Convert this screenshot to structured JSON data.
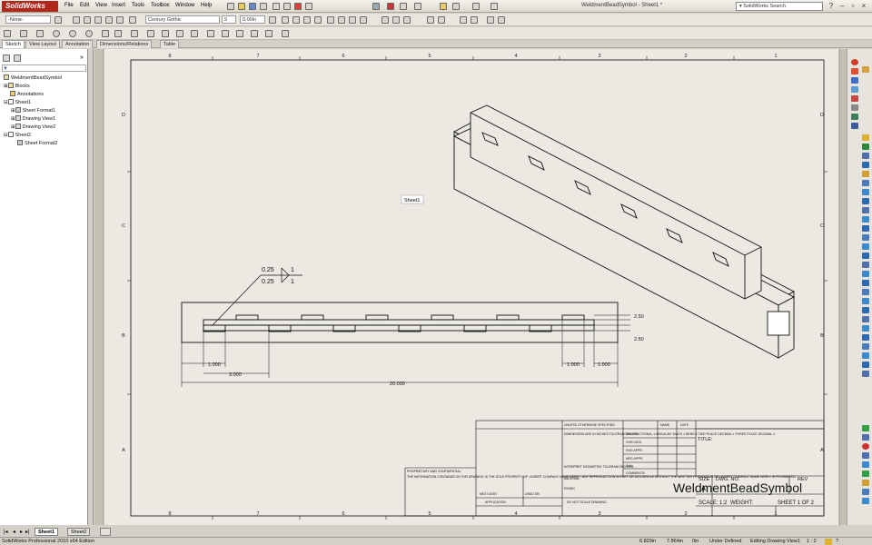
{
  "app": {
    "logo": "SolidWorks",
    "title": "WeldmentBeadSymbol - Sheet1 *",
    "search_placeholder": "SolidWorks Search"
  },
  "menu": [
    "File",
    "Edit",
    "View",
    "Insert",
    "Tools",
    "Toolbox",
    "Window",
    "Help"
  ],
  "format": {
    "layer": "-None-",
    "font": "Century Gothic",
    "size": "9",
    "spacing": "0.00in"
  },
  "tabs": [
    "Sketch",
    "View Layout",
    "Annotation",
    "Dimensions/Relations",
    "Table"
  ],
  "tree": [
    {
      "label": "WeldmentBeadSymbol",
      "icon": "drawing-icon"
    },
    {
      "label": "Blocks",
      "icon": "folder-icon"
    },
    {
      "label": "Annotations",
      "icon": "annotations-icon"
    },
    {
      "label": "Sheet1",
      "icon": "sheet-icon"
    },
    {
      "label": "Sheet Format1",
      "icon": "sheet-format-icon"
    },
    {
      "label": "Drawing View1",
      "icon": "view-icon"
    },
    {
      "label": "Drawing View2",
      "icon": "view-icon"
    },
    {
      "label": "Sheet2",
      "icon": "sheet-icon"
    },
    {
      "label": "Sheet Format2",
      "icon": "sheet-format-icon"
    }
  ],
  "drawing": {
    "zone_cols": [
      "8",
      "7",
      "6",
      "5",
      "4",
      "3",
      "2",
      "1"
    ],
    "zone_rows": [
      "D",
      "C",
      "B",
      "A"
    ],
    "sheet_label": "Sheet1",
    "weld_top": "0.25",
    "weld_bottom": "0.25",
    "weld_top_count": "1",
    "weld_bottom_count": "1",
    "dim_250a": "2.50",
    "dim_250b": "2.50",
    "dim_1000a": "1.000",
    "dim_3000": "3.000",
    "dim_1000b": "1.000",
    "dim_1000c": "1.000",
    "dim_20000": "20.000"
  },
  "title_block": {
    "unless": "UNLESS OTHERWISE SPECIFIED:",
    "name": "NAME",
    "date": "DATE",
    "drawn": "DRAWN",
    "checked": "CHECKED",
    "eng_appr": "ENG APPR.",
    "mfg_appr": "MFG APPR.",
    "qa": "Q.A.",
    "comments": "COMMENTS:",
    "dims_note": "DIMENSIONS ARE IN INCHES TOLERANCES: FRACTIONAL ± ANGULAR: MACH ± BEND ± TWO PLACE DECIMAL ± THREE PLACE DECIMAL ±",
    "interpret": "INTERPRET GEOMETRIC TOLERANCING PER:",
    "material": "MATERIAL",
    "finish": "FINISH",
    "next_assy": "NEXT ASSY",
    "used_on": "USED ON",
    "application": "APPLICATION",
    "do_not_scale": "DO NOT SCALE DRAWING",
    "proprietary_title": "PROPRIETARY AND CONFIDENTIAL",
    "proprietary_text": "THE INFORMATION CONTAINED IN THIS DRAWING IS THE SOLE PROPERTY OF <INSERT COMPANY NAME HERE>. ANY REPRODUCTION IN PART OR AS A WHOLE WITHOUT THE WRITTEN PERMISSION OF <INSERT COMPANY NAME HERE> IS PROHIBITED.",
    "title": "TITLE:",
    "size": "SIZE",
    "size_val": "A",
    "dwg_no": "DWG.  NO.",
    "rev": "REV",
    "part_name": "WeldmentBeadSymbol",
    "scale": "SCALE: 1:2",
    "weight": "WEIGHT:",
    "sheet": "SHEET 1 OF 2"
  },
  "sheet_tabs": [
    "Sheet1",
    "Sheet2"
  ],
  "status": {
    "app": "SolidWorks Professional 2010 x64 Edition",
    "x": "6.829in",
    "y": "7.864in",
    "z": "0in",
    "state": "Under Defined",
    "mode": "Editing Drawing View1",
    "scale": "1 : 2"
  }
}
